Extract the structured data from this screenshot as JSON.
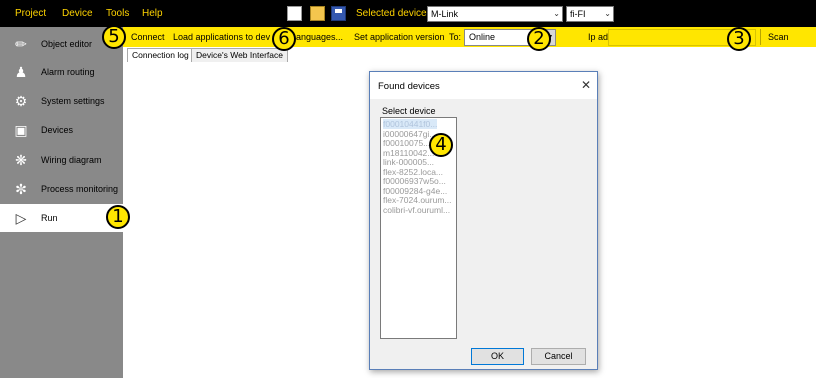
{
  "menu": [
    "Project",
    "Device",
    "Tools",
    "Help"
  ],
  "toolbar_icons": [
    "new-file-icon",
    "open-folder-icon",
    "save-disk-icon"
  ],
  "selected_device": {
    "label": "Selected device:",
    "value": "M-Link",
    "locale": "fi-FI"
  },
  "actions": {
    "connect": "Connect",
    "load": "Load applications to dev",
    "languages": "anguages...",
    "set_version": "Set application version",
    "to_label": "To:",
    "to_value": "Online",
    "ip_label": "Ip address:",
    "ip_value": "",
    "scan": "Scan"
  },
  "sidebar": [
    {
      "label": "Object editor",
      "icon": "pencil-icon"
    },
    {
      "label": "Alarm routing",
      "icon": "users-icon"
    },
    {
      "label": "System settings",
      "icon": "gears-icon"
    },
    {
      "label": "Devices",
      "icon": "network-icon"
    },
    {
      "label": "Wiring diagram",
      "icon": "wiring-icon"
    },
    {
      "label": "Process monitoring",
      "icon": "process-icon"
    },
    {
      "label": "Run",
      "icon": "play-icon"
    }
  ],
  "tabs": [
    "Connection log",
    "Device's Web Interface"
  ],
  "dialog": {
    "title": "Found devices",
    "select_label": "Select device",
    "devices": [
      "f00010441f0...",
      "i00000647gi...",
      "f00010075...",
      "m18110042...",
      "link-000005...",
      "flex-8252.loca...",
      "f00006937w5o...",
      "f00009284-g4e...",
      "flex-7024.ourum...",
      "colibri-vf.ouruml..."
    ],
    "ok": "OK",
    "cancel": "Cancel"
  },
  "callouts": [
    "1",
    "2",
    "3",
    "4",
    "5",
    "6"
  ],
  "colors": {
    "accent": "#ffe600",
    "menu_text": "#ffd400",
    "sidebar_bg": "#898989",
    "topbar_bg": "#000000"
  }
}
